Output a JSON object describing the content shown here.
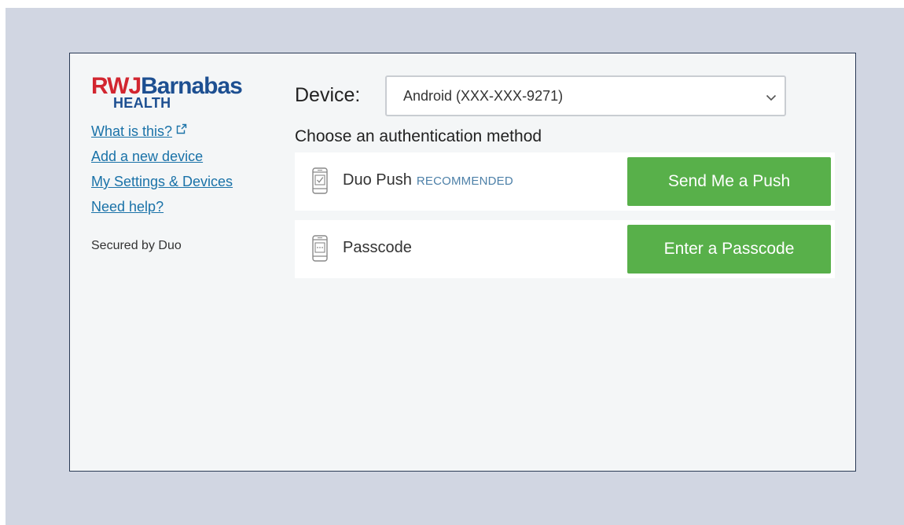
{
  "brand": {
    "logo_primary_red": "RWJ",
    "logo_primary_blue": "Barnabas",
    "logo_secondary": "HEALTH",
    "colors": {
      "red": "#d22630",
      "blue": "#1d4f91"
    }
  },
  "sidebar": {
    "links": [
      {
        "label": "What is this?",
        "icon": "external-link-icon"
      },
      {
        "label": "Add a new device"
      },
      {
        "label": "My Settings & Devices"
      },
      {
        "label": "Need help?"
      }
    ],
    "secured_text": "Secured by Duo"
  },
  "device": {
    "label": "Device:",
    "selected": "Android (XXX-XXX-9271)",
    "icon": "chevron-down-icon"
  },
  "auth": {
    "heading": "Choose an authentication method",
    "methods": [
      {
        "name": "Duo Push",
        "badge": "RECOMMENDED",
        "icon": "phone-check-icon",
        "button_label": "Send Me a Push"
      },
      {
        "name": "Passcode",
        "icon": "phone-passcode-icon",
        "button_label": "Enter a Passcode"
      }
    ]
  },
  "colors": {
    "accent_green": "#58b04a",
    "link_blue": "#1a72a8",
    "backdrop": "#d1d6e2"
  }
}
